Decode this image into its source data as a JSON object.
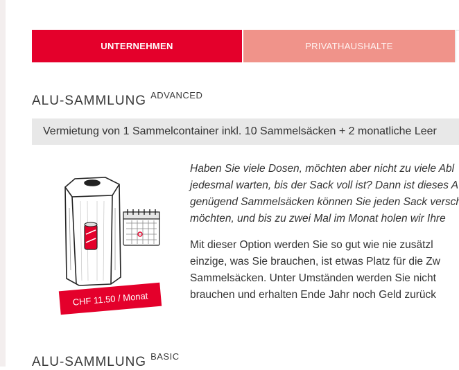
{
  "tabs": [
    {
      "label": "UNTERNEHMEN",
      "active": true
    },
    {
      "label": "PRIVATHAUSHALTE",
      "active": false
    },
    {
      "label": "",
      "active": false
    }
  ],
  "advanced": {
    "title": "ALU-SAMMLUNG",
    "tier": "ADVANCED",
    "info_bar": "Vermietung von 1 Sammelcontainer inkl. 10 Sammelsäcken + 2 monatliche Leer",
    "price": "CHF 11.50 / Monat",
    "italic_lines": [
      "Haben Sie viele Dosen, möchten aber nicht zu viele Abl",
      "jedesmal warten, bis der Sack voll ist? Dann ist dieses A",
      "genügend Sammelsäcken können Sie jeden Sack versch",
      "möchten, und bis zu zwei Mal im Monat holen wir Ihre"
    ],
    "body_lines": [
      "Mit dieser Option werden Sie so gut wie nie zusätzl",
      "einzige, was Sie brauchen, ist etwas Platz für die Zw",
      "Sammelsäcken. Unter Umständen werden Sie nicht",
      "brauchen und erhalten Ende Jahr noch Geld zurück"
    ]
  },
  "basic": {
    "title": "ALU-SAMMLUNG",
    "tier": "BASIC"
  },
  "colors": {
    "brand_red": "#e4002b",
    "tab_inactive": "#f0938a",
    "info_bar_bg": "#e8e8e8"
  },
  "icons": [
    "container-illustration",
    "calendar-icon",
    "can-icon"
  ]
}
